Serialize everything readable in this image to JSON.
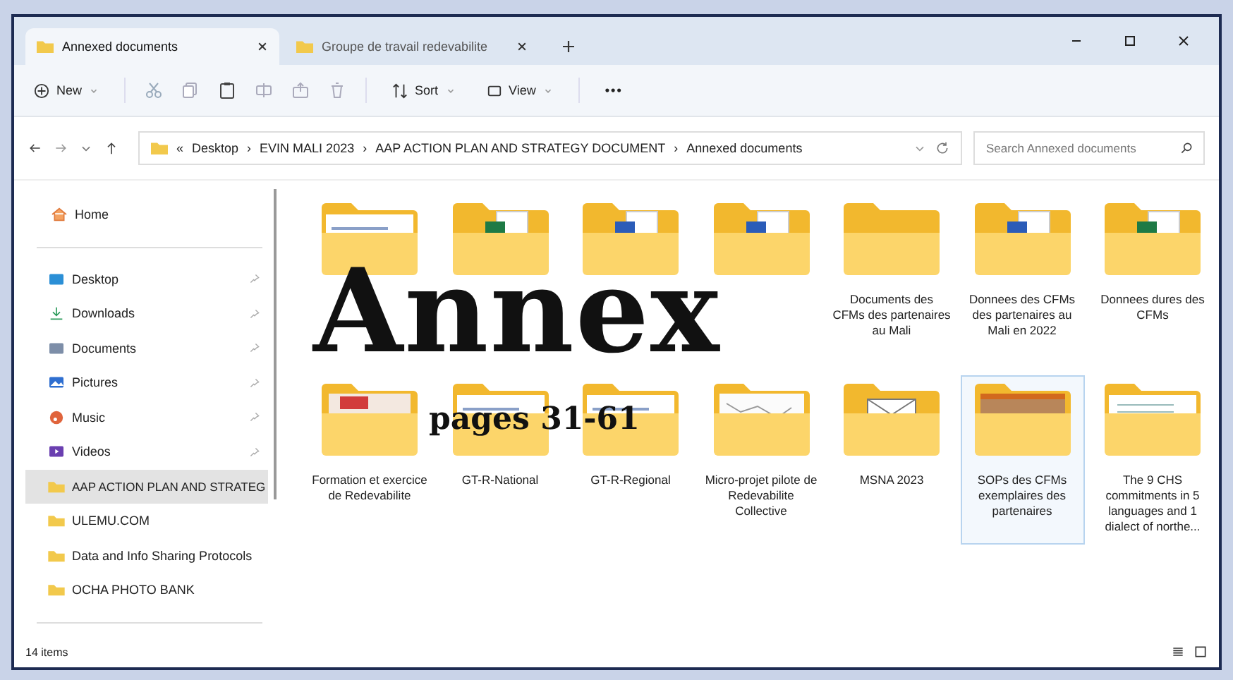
{
  "overlay": {
    "title": "Annex",
    "subtitle": "pages 31-61"
  },
  "tabs": [
    {
      "label": "Annexed documents",
      "selected": true
    },
    {
      "label": "Groupe de travail redevabilite",
      "selected": false
    }
  ],
  "toolbar": {
    "new": "New",
    "sort": "Sort",
    "view": "View",
    "more": "•••"
  },
  "address": {
    "prefix": "«",
    "crumbs": [
      "Desktop",
      "EVIN MALI 2023",
      "AAP ACTION PLAN AND STRATEGY DOCUMENT",
      "Annexed documents"
    ],
    "separator": "›"
  },
  "search": {
    "placeholder": "Search Annexed documents"
  },
  "sidebar": {
    "home": "Home",
    "items": [
      {
        "label": "Desktop",
        "kind": "desktop",
        "pinned": true,
        "selected": false
      },
      {
        "label": "Downloads",
        "kind": "download",
        "pinned": true,
        "selected": false
      },
      {
        "label": "Documents",
        "kind": "documents",
        "pinned": true,
        "selected": false
      },
      {
        "label": "Pictures",
        "kind": "pictures",
        "pinned": true,
        "selected": false
      },
      {
        "label": "Music",
        "kind": "music",
        "pinned": true,
        "selected": false
      },
      {
        "label": "Videos",
        "kind": "videos",
        "pinned": true,
        "selected": false
      },
      {
        "label": "AAP ACTION PLAN AND STRATEG",
        "kind": "folder",
        "pinned": false,
        "selected": true
      },
      {
        "label": "ULEMU.COM",
        "kind": "folder",
        "pinned": false,
        "selected": false
      },
      {
        "label": "Data and Info Sharing Protocols",
        "kind": "folder",
        "pinned": false,
        "selected": false
      },
      {
        "label": "OCHA PHOTO BANK",
        "kind": "folder",
        "pinned": false,
        "selected": false
      }
    ]
  },
  "folders": [
    {
      "kind": "page",
      "selected": false
    },
    {
      "kind": "excel",
      "selected": false
    },
    {
      "kind": "word",
      "selected": false
    },
    {
      "kind": "word",
      "selected": false
    },
    {
      "label": "Documents des CFMs des partenaires au Mali",
      "kind": "plain",
      "selected": false
    },
    {
      "label": "Donnees des CFMs des partenaires au Mali en 2022",
      "kind": "word",
      "selected": false
    },
    {
      "label": "Donnees dures des CFMs",
      "kind": "excel",
      "selected": false
    },
    {
      "label": "Formation et exercice de Redevabilite",
      "kind": "pdf",
      "selected": false
    },
    {
      "label": "GT-R-National",
      "kind": "page",
      "selected": false
    },
    {
      "label": "GT-R-Regional",
      "kind": "page",
      "selected": false
    },
    {
      "label": "Micro-projet pilote de Redevabilite Collective",
      "kind": "sketch",
      "selected": false
    },
    {
      "label": "MSNA 2023",
      "kind": "envelope",
      "selected": false
    },
    {
      "label": "SOPs des CFMs exemplaires des partenaires",
      "kind": "photo",
      "selected": true
    },
    {
      "label": "The 9 CHS commitments in 5 languages and 1 dialect of northe...",
      "kind": "list",
      "selected": false
    }
  ],
  "status_bar": {
    "count": "14 items"
  }
}
